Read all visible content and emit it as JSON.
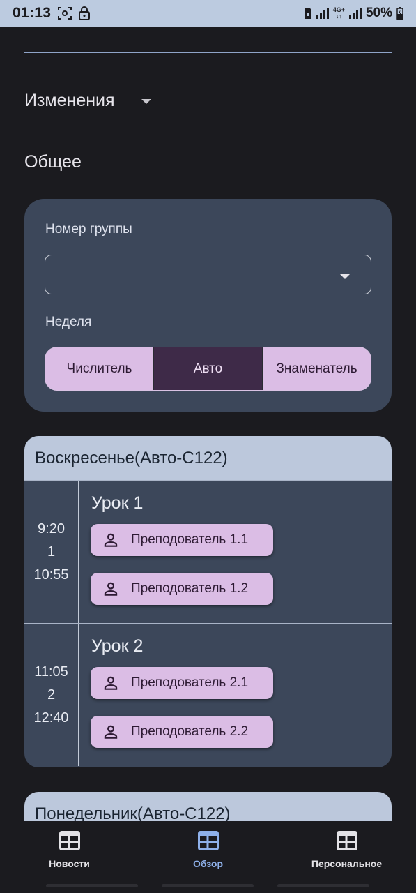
{
  "status_bar": {
    "time": "01:13",
    "network": "4G+",
    "battery": "50%",
    "icons": [
      "screenshot-icon",
      "lock-icon",
      "sim-icon",
      "signal-icon",
      "network-4g-icon",
      "signal-icon",
      "battery-icon"
    ]
  },
  "section": {
    "title": "Изменения",
    "general_title": "Общее"
  },
  "settings": {
    "group_label": "Номер группы",
    "group_value": "",
    "week_label": "Неделя",
    "week_options": [
      "Числитель",
      "Авто",
      "Знаменатель"
    ],
    "week_selected": "Авто"
  },
  "schedule": {
    "days": [
      {
        "title": "Воскресенье(Авто-С122)",
        "lessons": [
          {
            "start": "9:20",
            "number": "1",
            "end": "10:55",
            "name": "Урок 1",
            "teachers": [
              "Преподователь 1.1",
              "Преподователь 1.2"
            ]
          },
          {
            "start": "11:05",
            "number": "2",
            "end": "12:40",
            "name": "Урок 2",
            "teachers": [
              "Преподователь 2.1",
              "Преподователь 2.2"
            ]
          }
        ]
      },
      {
        "title": "Понедельник(Авто-С122)"
      }
    ]
  },
  "bottom_nav": {
    "items": [
      {
        "label": "Новости",
        "icon": "table-icon"
      },
      {
        "label": "Обзор",
        "icon": "table-icon",
        "active": true
      },
      {
        "label": "Персональное",
        "icon": "table-icon"
      }
    ]
  },
  "colors": {
    "background": "#1b1b1f",
    "card": "#3c475a",
    "header": "#bcc8dc",
    "chip": "#dbbde5",
    "segment_active": "#3e2a48",
    "accent": "#8fb1ea"
  }
}
